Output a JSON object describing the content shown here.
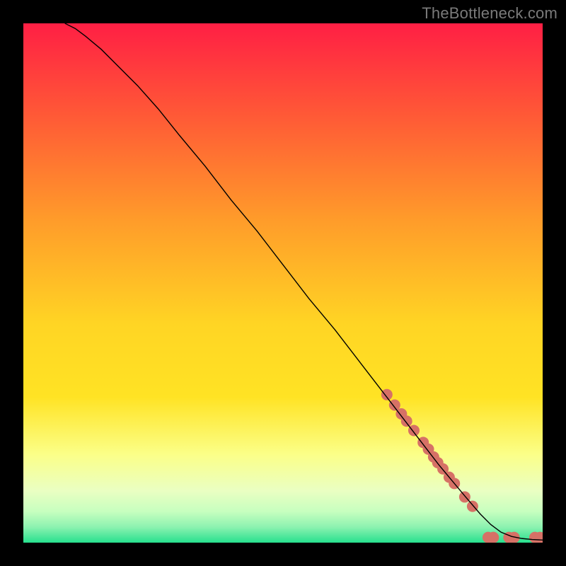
{
  "watermark": "TheBottleneck.com",
  "chart_data": {
    "type": "line",
    "title": "",
    "xlabel": "",
    "ylabel": "",
    "xlim": [
      0,
      100
    ],
    "ylim": [
      0,
      100
    ],
    "grid": false,
    "legend": false,
    "background_gradient": {
      "top": "#ff1f44",
      "mid_upper": "#ff9c2a",
      "mid": "#ffe324",
      "mid_lower": "#fbff88",
      "low": "#c7ffbf",
      "bottom": "#27e08e"
    },
    "series": [
      {
        "name": "bottleneck-curve",
        "color": "#000000",
        "stroke_width": 1.4,
        "x": [
          8,
          10,
          12,
          15,
          18,
          22,
          26,
          30,
          35,
          40,
          45,
          50,
          55,
          60,
          65,
          70,
          75,
          80,
          85,
          88,
          90,
          92,
          94,
          96,
          98,
          100
        ],
        "y": [
          100,
          99,
          97.5,
          95,
          92,
          88,
          83.5,
          78.5,
          72.5,
          66,
          60,
          53.5,
          47,
          41,
          34.5,
          28,
          21.5,
          15,
          9,
          5.5,
          3.5,
          2,
          1.2,
          0.8,
          0.6,
          0.5
        ]
      }
    ],
    "scatter": {
      "name": "highlighted-points",
      "color": "#d67166",
      "radius": 8,
      "points": [
        {
          "x": 70.0,
          "y": 28.5
        },
        {
          "x": 71.5,
          "y": 26.5
        },
        {
          "x": 72.8,
          "y": 24.8
        },
        {
          "x": 73.8,
          "y": 23.4
        },
        {
          "x": 75.2,
          "y": 21.6
        },
        {
          "x": 77.0,
          "y": 19.3
        },
        {
          "x": 78.0,
          "y": 18.0
        },
        {
          "x": 79.0,
          "y": 16.5
        },
        {
          "x": 79.8,
          "y": 15.4
        },
        {
          "x": 80.8,
          "y": 14.2
        },
        {
          "x": 82.0,
          "y": 12.6
        },
        {
          "x": 83.0,
          "y": 11.4
        },
        {
          "x": 85.0,
          "y": 8.8
        },
        {
          "x": 86.5,
          "y": 7.0
        },
        {
          "x": 89.5,
          "y": 1.0
        },
        {
          "x": 90.5,
          "y": 1.0
        },
        {
          "x": 93.5,
          "y": 1.0
        },
        {
          "x": 94.5,
          "y": 1.0
        },
        {
          "x": 98.5,
          "y": 1.0
        },
        {
          "x": 99.5,
          "y": 1.0
        }
      ]
    }
  }
}
